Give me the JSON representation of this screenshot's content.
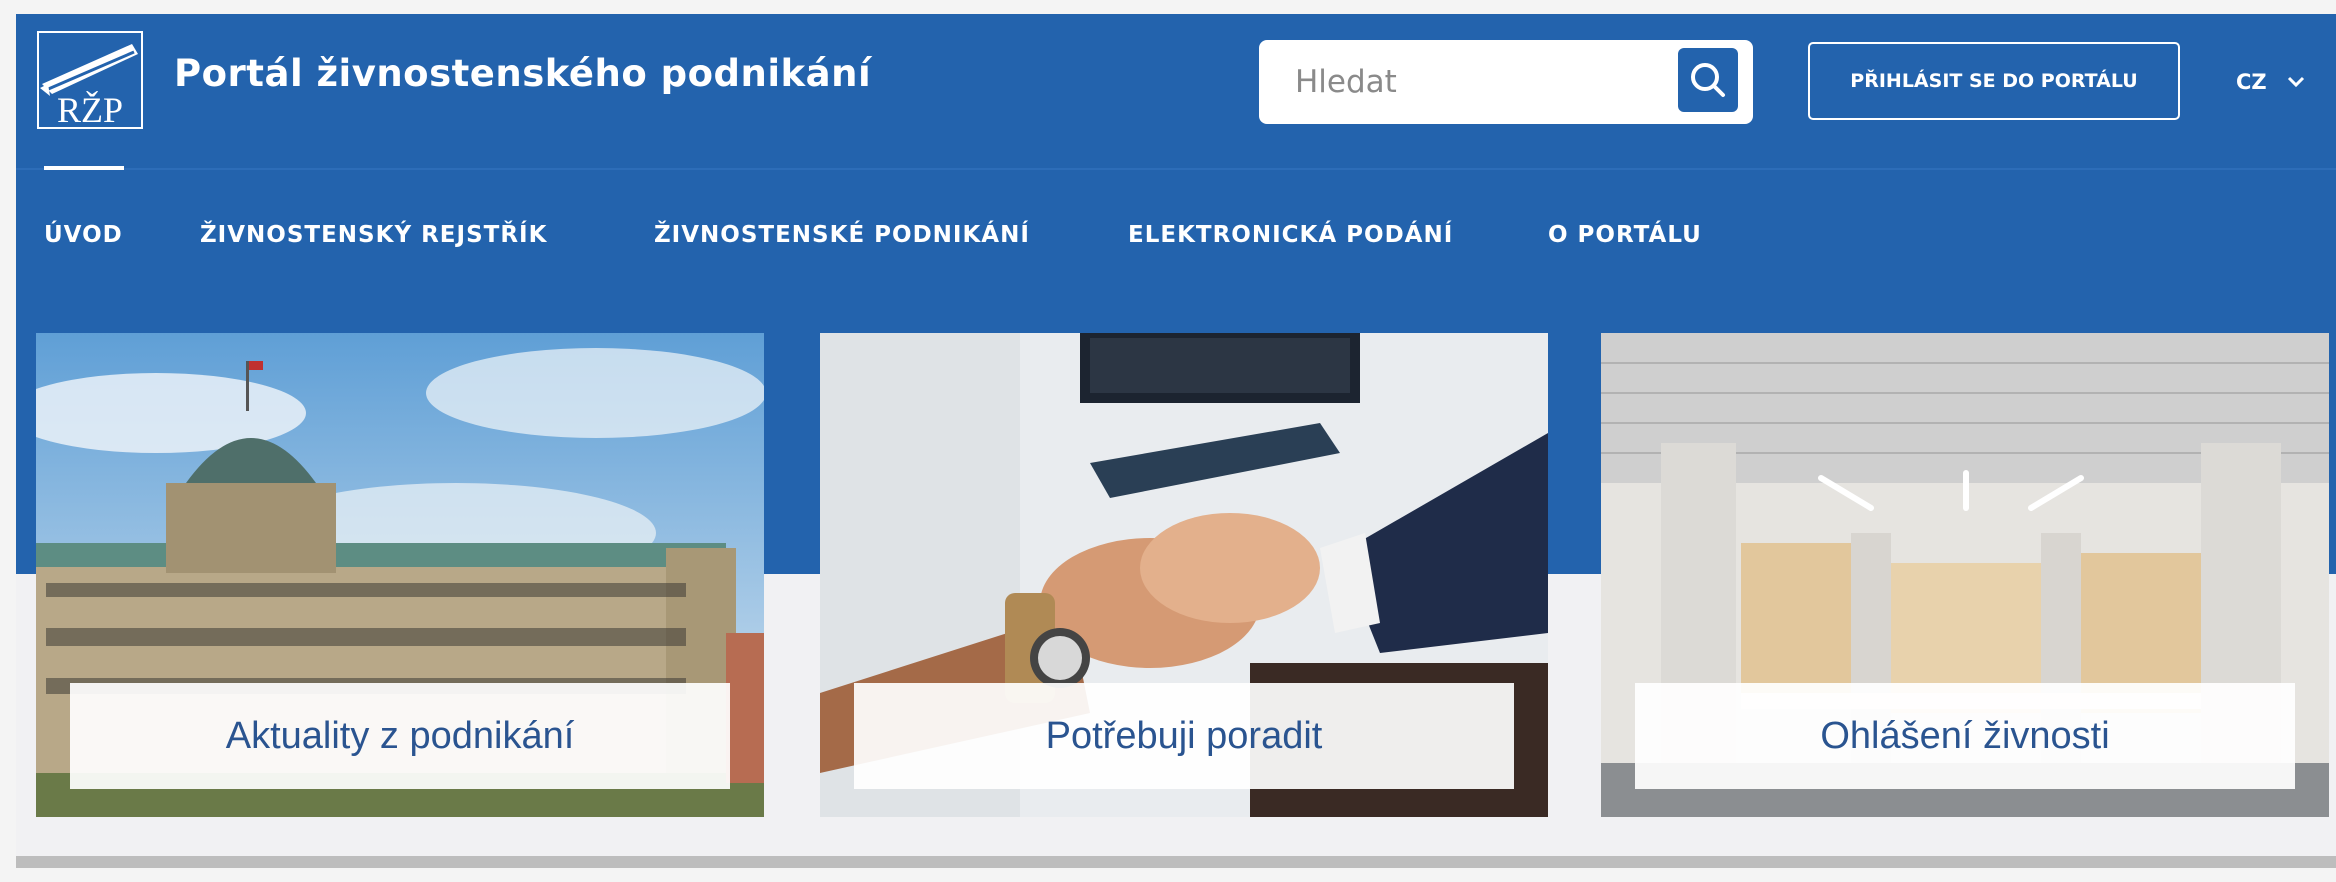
{
  "header": {
    "logo_text": "RŽP",
    "title": "Portál živnostenského podnikání",
    "search_placeholder": "Hledat",
    "search_icon": "search-icon",
    "login_label": "PŘIHLÁSIT SE DO PORTÁLU",
    "language": "CZ",
    "language_icon": "chevron-down-icon"
  },
  "nav": {
    "active_index": 0,
    "items": [
      {
        "label": "ÚVOD"
      },
      {
        "label": "ŽIVNOSTENSKÝ REJSTŘÍK"
      },
      {
        "label": "ŽIVNOSTENSKÉ PODNIKÁNÍ"
      },
      {
        "label": "ELEKTRONICKÁ PODÁNÍ"
      },
      {
        "label": "O PORTÁLU"
      }
    ]
  },
  "cards": [
    {
      "label": "Aktuality z podnikání",
      "image": "historic-building-photo"
    },
    {
      "label": "Potřebuji poradit",
      "image": "handshake-photo"
    },
    {
      "label": "Ohlášení živnosti",
      "image": "office-interior-photo"
    }
  ],
  "colors": {
    "primary": "#2363ad",
    "card_label_text": "#2a5490",
    "page_bg": "#f1f1f3"
  }
}
